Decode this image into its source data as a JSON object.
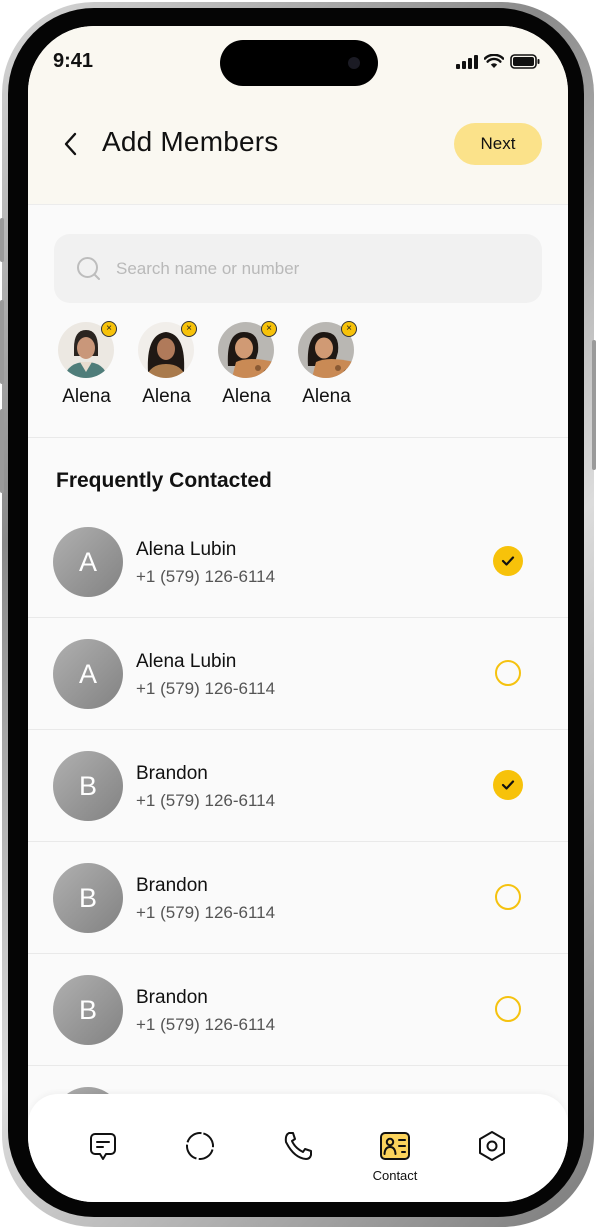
{
  "status_bar": {
    "time": "9:41"
  },
  "header": {
    "title": "Add Members",
    "next_label": "Next"
  },
  "search": {
    "placeholder": "Search name or number",
    "value": ""
  },
  "selected_members": [
    {
      "name": "Alena",
      "photo": "woman-teal-jacket"
    },
    {
      "name": "Alena",
      "photo": "woman-wavy-hair"
    },
    {
      "name": "Alena",
      "photo": "woman-smiling-tattoo"
    },
    {
      "name": "Alena",
      "photo": "woman-smiling-tattoo"
    }
  ],
  "section_title": "Frequently Contacted",
  "contacts": [
    {
      "initial": "A",
      "name": "Alena Lubin",
      "phone": "+1 (579) 126-6114",
      "selected": true
    },
    {
      "initial": "A",
      "name": "Alena Lubin",
      "phone": "+1 (579) 126-6114",
      "selected": false
    },
    {
      "initial": "B",
      "name": "Brandon",
      "phone": "+1 (579) 126-6114",
      "selected": true
    },
    {
      "initial": "B",
      "name": "Brandon",
      "phone": "+1 (579) 126-6114",
      "selected": false
    },
    {
      "initial": "B",
      "name": "Brandon",
      "phone": "+1 (579) 126-6114",
      "selected": false
    }
  ],
  "tabbar": {
    "active": "contact",
    "items": [
      {
        "id": "chats",
        "icon": "chat-bubble-icon",
        "label": ""
      },
      {
        "id": "status",
        "icon": "status-circle-icon",
        "label": ""
      },
      {
        "id": "calls",
        "icon": "phone-icon",
        "label": ""
      },
      {
        "id": "contact",
        "icon": "contact-card-icon",
        "label": "Contact"
      },
      {
        "id": "settings",
        "icon": "settings-hexagon-icon",
        "label": ""
      }
    ]
  },
  "colors": {
    "accent": "#f7c20a",
    "next_button": "#fbe28a",
    "header_bg": "#faf8f1",
    "background": "#fafafa"
  }
}
